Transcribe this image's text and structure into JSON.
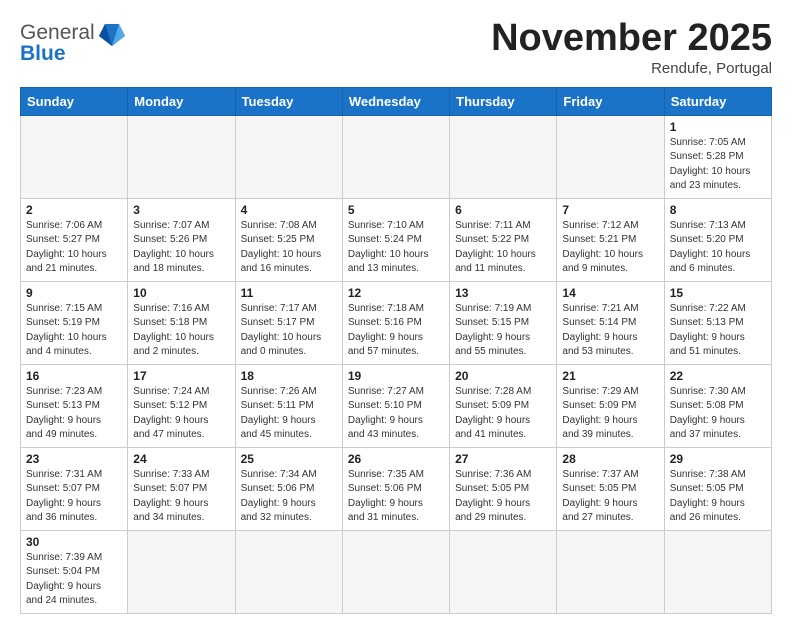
{
  "logo": {
    "text_normal": "General",
    "text_blue": "Blue"
  },
  "title": "November 2025",
  "location": "Rendufe, Portugal",
  "weekdays": [
    "Sunday",
    "Monday",
    "Tuesday",
    "Wednesday",
    "Thursday",
    "Friday",
    "Saturday"
  ],
  "weeks": [
    [
      {
        "day": "",
        "info": ""
      },
      {
        "day": "",
        "info": ""
      },
      {
        "day": "",
        "info": ""
      },
      {
        "day": "",
        "info": ""
      },
      {
        "day": "",
        "info": ""
      },
      {
        "day": "",
        "info": ""
      },
      {
        "day": "1",
        "info": "Sunrise: 7:05 AM\nSunset: 5:28 PM\nDaylight: 10 hours\nand 23 minutes."
      }
    ],
    [
      {
        "day": "2",
        "info": "Sunrise: 7:06 AM\nSunset: 5:27 PM\nDaylight: 10 hours\nand 21 minutes."
      },
      {
        "day": "3",
        "info": "Sunrise: 7:07 AM\nSunset: 5:26 PM\nDaylight: 10 hours\nand 18 minutes."
      },
      {
        "day": "4",
        "info": "Sunrise: 7:08 AM\nSunset: 5:25 PM\nDaylight: 10 hours\nand 16 minutes."
      },
      {
        "day": "5",
        "info": "Sunrise: 7:10 AM\nSunset: 5:24 PM\nDaylight: 10 hours\nand 13 minutes."
      },
      {
        "day": "6",
        "info": "Sunrise: 7:11 AM\nSunset: 5:22 PM\nDaylight: 10 hours\nand 11 minutes."
      },
      {
        "day": "7",
        "info": "Sunrise: 7:12 AM\nSunset: 5:21 PM\nDaylight: 10 hours\nand 9 minutes."
      },
      {
        "day": "8",
        "info": "Sunrise: 7:13 AM\nSunset: 5:20 PM\nDaylight: 10 hours\nand 6 minutes."
      }
    ],
    [
      {
        "day": "9",
        "info": "Sunrise: 7:15 AM\nSunset: 5:19 PM\nDaylight: 10 hours\nand 4 minutes."
      },
      {
        "day": "10",
        "info": "Sunrise: 7:16 AM\nSunset: 5:18 PM\nDaylight: 10 hours\nand 2 minutes."
      },
      {
        "day": "11",
        "info": "Sunrise: 7:17 AM\nSunset: 5:17 PM\nDaylight: 10 hours\nand 0 minutes."
      },
      {
        "day": "12",
        "info": "Sunrise: 7:18 AM\nSunset: 5:16 PM\nDaylight: 9 hours\nand 57 minutes."
      },
      {
        "day": "13",
        "info": "Sunrise: 7:19 AM\nSunset: 5:15 PM\nDaylight: 9 hours\nand 55 minutes."
      },
      {
        "day": "14",
        "info": "Sunrise: 7:21 AM\nSunset: 5:14 PM\nDaylight: 9 hours\nand 53 minutes."
      },
      {
        "day": "15",
        "info": "Sunrise: 7:22 AM\nSunset: 5:13 PM\nDaylight: 9 hours\nand 51 minutes."
      }
    ],
    [
      {
        "day": "16",
        "info": "Sunrise: 7:23 AM\nSunset: 5:13 PM\nDaylight: 9 hours\nand 49 minutes."
      },
      {
        "day": "17",
        "info": "Sunrise: 7:24 AM\nSunset: 5:12 PM\nDaylight: 9 hours\nand 47 minutes."
      },
      {
        "day": "18",
        "info": "Sunrise: 7:26 AM\nSunset: 5:11 PM\nDaylight: 9 hours\nand 45 minutes."
      },
      {
        "day": "19",
        "info": "Sunrise: 7:27 AM\nSunset: 5:10 PM\nDaylight: 9 hours\nand 43 minutes."
      },
      {
        "day": "20",
        "info": "Sunrise: 7:28 AM\nSunset: 5:09 PM\nDaylight: 9 hours\nand 41 minutes."
      },
      {
        "day": "21",
        "info": "Sunrise: 7:29 AM\nSunset: 5:09 PM\nDaylight: 9 hours\nand 39 minutes."
      },
      {
        "day": "22",
        "info": "Sunrise: 7:30 AM\nSunset: 5:08 PM\nDaylight: 9 hours\nand 37 minutes."
      }
    ],
    [
      {
        "day": "23",
        "info": "Sunrise: 7:31 AM\nSunset: 5:07 PM\nDaylight: 9 hours\nand 36 minutes."
      },
      {
        "day": "24",
        "info": "Sunrise: 7:33 AM\nSunset: 5:07 PM\nDaylight: 9 hours\nand 34 minutes."
      },
      {
        "day": "25",
        "info": "Sunrise: 7:34 AM\nSunset: 5:06 PM\nDaylight: 9 hours\nand 32 minutes."
      },
      {
        "day": "26",
        "info": "Sunrise: 7:35 AM\nSunset: 5:06 PM\nDaylight: 9 hours\nand 31 minutes."
      },
      {
        "day": "27",
        "info": "Sunrise: 7:36 AM\nSunset: 5:05 PM\nDaylight: 9 hours\nand 29 minutes."
      },
      {
        "day": "28",
        "info": "Sunrise: 7:37 AM\nSunset: 5:05 PM\nDaylight: 9 hours\nand 27 minutes."
      },
      {
        "day": "29",
        "info": "Sunrise: 7:38 AM\nSunset: 5:05 PM\nDaylight: 9 hours\nand 26 minutes."
      }
    ],
    [
      {
        "day": "30",
        "info": "Sunrise: 7:39 AM\nSunset: 5:04 PM\nDaylight: 9 hours\nand 24 minutes."
      },
      {
        "day": "",
        "info": ""
      },
      {
        "day": "",
        "info": ""
      },
      {
        "day": "",
        "info": ""
      },
      {
        "day": "",
        "info": ""
      },
      {
        "day": "",
        "info": ""
      },
      {
        "day": "",
        "info": ""
      }
    ]
  ]
}
